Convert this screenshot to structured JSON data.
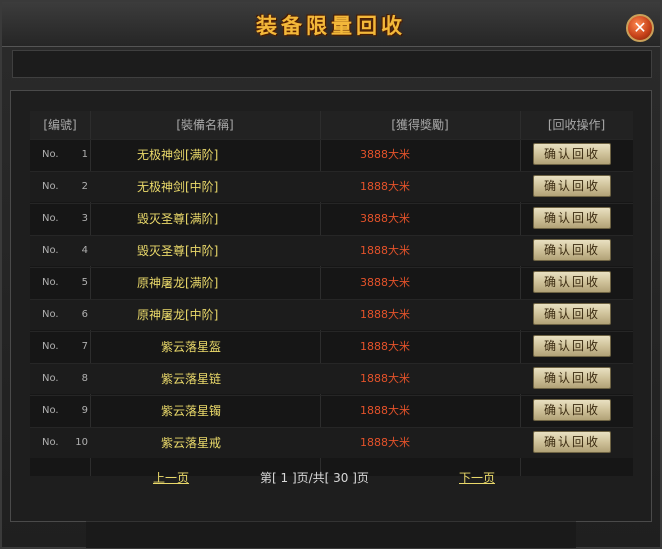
{
  "window": {
    "title": "装备限量回收",
    "close_symbol": "✕"
  },
  "table": {
    "headers": [
      "[编號]",
      "[裝備名稱]",
      "[獲得獎勵]",
      "[回收操作]"
    ],
    "no_prefix": "No.",
    "rows": [
      {
        "num": "1",
        "name": "无极神剑[满阶]",
        "reward": "3888大米",
        "action": "确认回收"
      },
      {
        "num": "2",
        "name": "无极神剑[中阶]",
        "reward": "1888大米",
        "action": "确认回收"
      },
      {
        "num": "3",
        "name": "毁灭圣尊[满阶]",
        "reward": "3888大米",
        "action": "确认回收"
      },
      {
        "num": "4",
        "name": "毁灭圣尊[中阶]",
        "reward": "1888大米",
        "action": "确认回收"
      },
      {
        "num": "5",
        "name": "原神屠龙[满阶]",
        "reward": "3888大米",
        "action": "确认回收"
      },
      {
        "num": "6",
        "name": "原神屠龙[中阶]",
        "reward": "1888大米",
        "action": "确认回收"
      },
      {
        "num": "7",
        "name": "紫云落星盔",
        "reward": "1888大米",
        "action": "确认回收"
      },
      {
        "num": "8",
        "name": "紫云落星链",
        "reward": "1888大米",
        "action": "确认回收"
      },
      {
        "num": "9",
        "name": "紫云落星镯",
        "reward": "1888大米",
        "action": "确认回收"
      },
      {
        "num": "10",
        "name": "紫云落星戒",
        "reward": "1888大米",
        "action": "确认回收"
      }
    ]
  },
  "pager": {
    "prev": "上一页",
    "info": "第[ 1 ]页/共[ 30 ]页",
    "next": "下一页"
  },
  "colors": {
    "title": "#f3b83a",
    "name": "#ead96a",
    "reward": "#e4522a"
  }
}
